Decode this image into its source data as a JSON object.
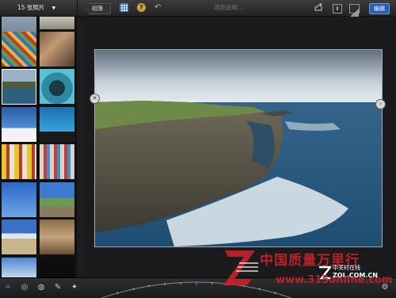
{
  "header": {
    "photo_count": "15 张照片",
    "album_label": "相簿",
    "caption_placeholder": "添加说明...",
    "info_label": "i",
    "help_label": "?",
    "edit_label": "编辑"
  },
  "watermark": {
    "brand": "中国质量万里行",
    "url": "www.315online.com",
    "logo_cn": "中关村在线",
    "logo_en": "ZOL.COM.CN"
  },
  "icons": {
    "menu": "chevron-down-icon",
    "grid": "grid-icon",
    "help": "help-icon",
    "undo": "undo-icon",
    "share": "share-icon",
    "info": "info-icon",
    "compare": "compare-icon",
    "crop": "crop-icon",
    "exposure": "exposure-icon",
    "color": "color-palette-icon",
    "brushes": "brushes-icon",
    "effects": "effects-icon",
    "settings": "gear-icon",
    "rotate_left": "rotate-left-icon",
    "rotate_right": "rotate-right-icon"
  },
  "colors": {
    "accent": "#3f7fe0",
    "edit_button": "#2b5eb0",
    "watermark_red": "#c8222a"
  }
}
